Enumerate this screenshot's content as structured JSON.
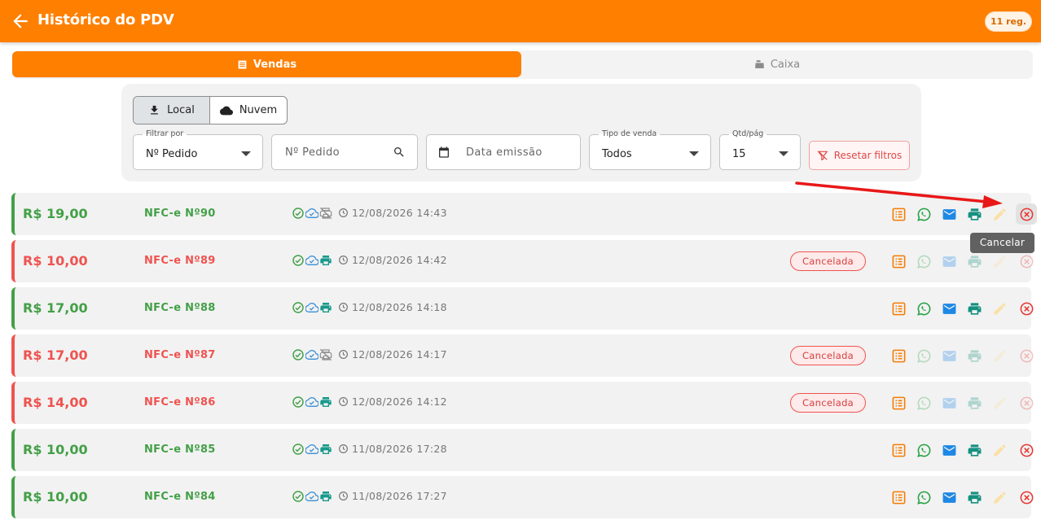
{
  "header": {
    "title": "Histórico do PDV",
    "count_badge": "11 reg."
  },
  "tabs": [
    {
      "label": "Vendas",
      "icon": "receipt-icon",
      "active": true
    },
    {
      "label": "Caixa",
      "icon": "cash-register-icon",
      "active": false
    }
  ],
  "source_toggle": {
    "local_label": "Local",
    "nuvem_label": "Nuvem",
    "selected": "Local"
  },
  "filters": {
    "filter_by": {
      "label": "Filtrar por",
      "value": "Nº Pedido"
    },
    "search": {
      "placeholder": "Nº Pedido"
    },
    "date": {
      "placeholder": "Data emissão"
    },
    "sale_type": {
      "label": "Tipo de venda",
      "value": "Todos"
    },
    "per_page": {
      "label": "Qtd/pág",
      "value": "15"
    },
    "reset_label": "Resetar filtros"
  },
  "colors": {
    "brand": "#ff7f00",
    "ok": "#43a047",
    "cancelled": "#ef5350"
  },
  "sales": [
    {
      "amount": "R$ 19,00",
      "doc": "NFC-e Nº90",
      "datetime": "12/08/2026 14:43",
      "cancelled": false,
      "badge": "",
      "printed": false
    },
    {
      "amount": "R$ 10,00",
      "doc": "NFC-e Nº89",
      "datetime": "12/08/2026 14:42",
      "cancelled": true,
      "badge": "Cancelada",
      "printed": true
    },
    {
      "amount": "R$ 17,00",
      "doc": "NFC-e Nº88",
      "datetime": "12/08/2026 14:18",
      "cancelled": false,
      "badge": "",
      "printed": true
    },
    {
      "amount": "R$ 17,00",
      "doc": "NFC-e Nº87",
      "datetime": "12/08/2026 14:17",
      "cancelled": true,
      "badge": "Cancelada",
      "printed": false
    },
    {
      "amount": "R$ 14,00",
      "doc": "NFC-e Nº86",
      "datetime": "12/08/2026 14:12",
      "cancelled": true,
      "badge": "Cancelada",
      "printed": true
    },
    {
      "amount": "R$ 10,00",
      "doc": "NFC-e Nº85",
      "datetime": "11/08/2026 17:28",
      "cancelled": false,
      "badge": "",
      "printed": true
    },
    {
      "amount": "R$ 10,00",
      "doc": "NFC-e Nº84",
      "datetime": "11/08/2026 17:27",
      "cancelled": false,
      "badge": "",
      "printed": true
    }
  ],
  "tooltip": {
    "text": "Cancelar"
  }
}
